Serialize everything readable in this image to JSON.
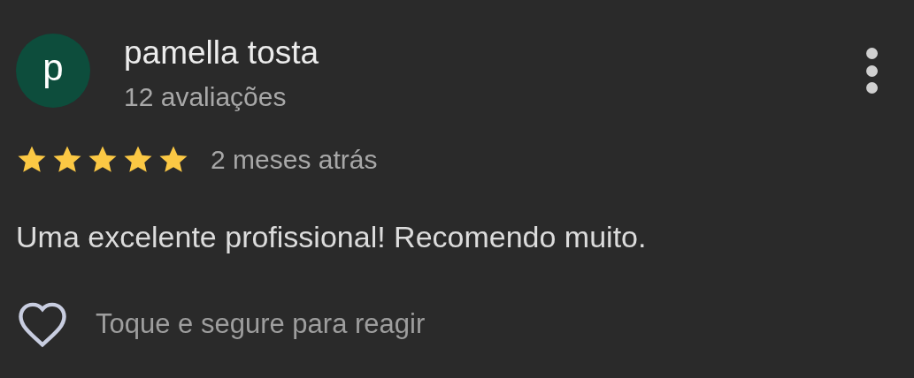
{
  "review": {
    "avatar_letter": "p",
    "author": "pamella tosta",
    "review_count": "12 avaliações",
    "stars": 5,
    "time": "2 meses atrás",
    "text": "Uma excelente profissional! Recomendo muito.",
    "reaction_hint": "Toque e segure para reagir"
  }
}
